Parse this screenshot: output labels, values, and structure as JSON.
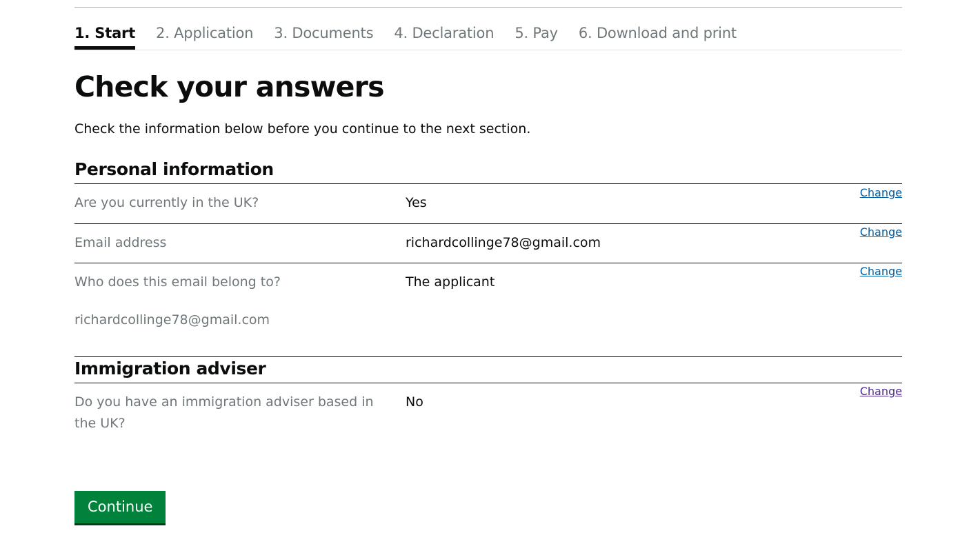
{
  "steps": [
    {
      "label": "1. Start",
      "active": true
    },
    {
      "label": "2. Application"
    },
    {
      "label": "3. Documents"
    },
    {
      "label": "4. Declaration"
    },
    {
      "label": "5. Pay"
    },
    {
      "label": "6. Download and print"
    }
  ],
  "heading": "Check your answers",
  "intro": "Check the information below before you continue to the next section.",
  "sections": {
    "personal": {
      "title": "Personal information",
      "rows": [
        {
          "question": "Are you currently in the UK?",
          "answer": "Yes",
          "action": "Change"
        },
        {
          "question": "Email address",
          "answer": "richardcollinge78@gmail.com",
          "action": "Change"
        },
        {
          "question": "Who does this email belong to?",
          "answer": "The applicant",
          "extra": "richardcollinge78@gmail.com",
          "action": "Change"
        }
      ]
    },
    "immigration": {
      "title": "Immigration adviser",
      "rows": [
        {
          "question": "Do you have an immigration adviser based in the UK?",
          "answer": "No",
          "action": "Change"
        }
      ]
    }
  },
  "continue_label": "Continue",
  "colors": {
    "text": "#0b0c0c",
    "secondary_text": "#6f777b",
    "link": "#005ea5",
    "link_visited": "#4c2c92",
    "button": "#00823b"
  }
}
